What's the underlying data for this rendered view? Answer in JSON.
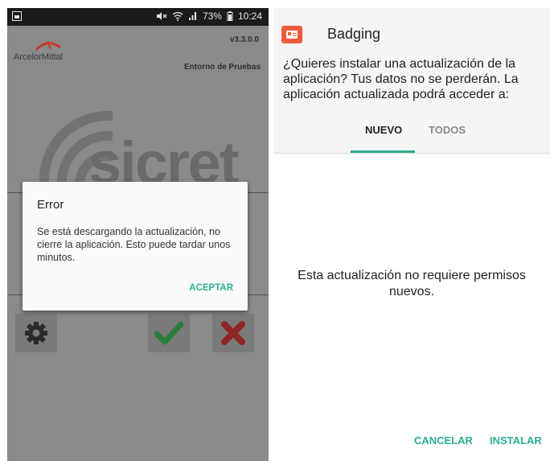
{
  "colors": {
    "accent": "#2aaf8f",
    "status_bar": "#1b1b1b",
    "dim_bg": "#8a8a8a",
    "app_icon": "#f05a3a"
  },
  "left": {
    "status_bar": {
      "battery": "73%",
      "time": "10:24"
    },
    "app": {
      "brand": "ArcelorMittal",
      "version": "v3.3.0.0",
      "environment": "Entorno de Pruebas",
      "logo_text": "sicret"
    },
    "dialog": {
      "title": "Error",
      "message": "Se está descargando la actualización, no cierre la aplicación. Esto puede tardar unos minutos.",
      "button": "ACEPTAR"
    },
    "toolbar": {
      "icons": [
        "gear-icon",
        "check-icon",
        "cross-icon"
      ]
    }
  },
  "right": {
    "app_name": "Badging",
    "question": "¿Quieres instalar una actualización de la aplicación? Tus datos no se perderán. La aplicación actualizada podrá acceder a:",
    "tabs": [
      {
        "label": "NUEVO",
        "active": true
      },
      {
        "label": "TODOS",
        "active": false
      }
    ],
    "message": "Esta actualización no requiere permisos nuevos.",
    "buttons": {
      "cancel": "CANCELAR",
      "install": "INSTALAR"
    }
  }
}
